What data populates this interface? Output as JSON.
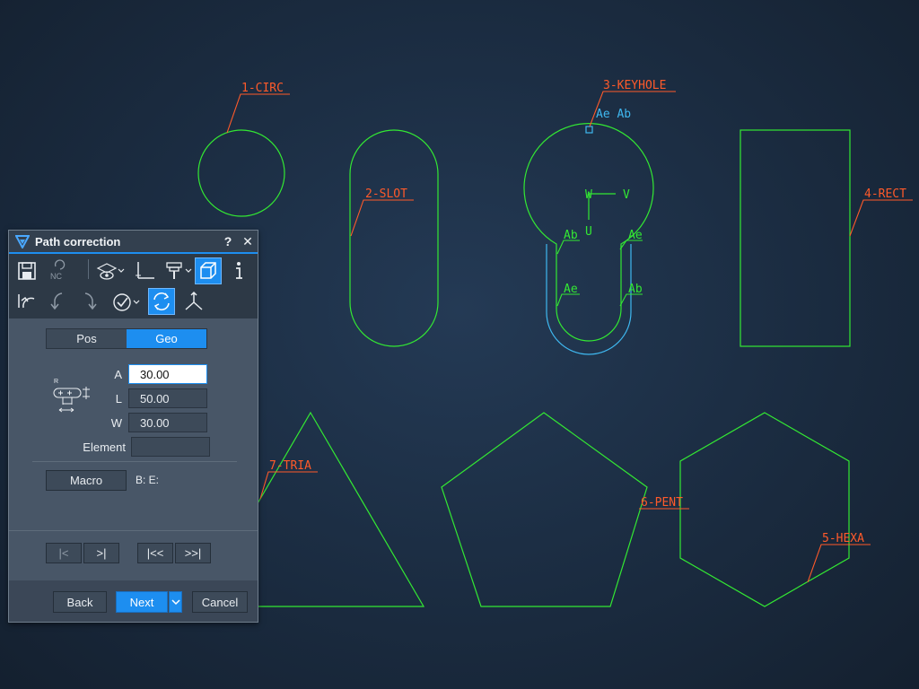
{
  "canvas": {
    "labels": {
      "circ": "1-CIRC",
      "slot": "2-SLOT",
      "keyhole": "3-KEYHOLE",
      "rect": "4-RECT",
      "hexa": "5-HEXA",
      "pent": "6-PENT",
      "tria": "7-TRIA"
    },
    "keyhole_marks": {
      "top": "Ae Ab",
      "w": "W",
      "v": "V",
      "u": "U",
      "ab_left": "Ab",
      "ae_right": "Ae",
      "ae_left": "Ae",
      "ab_right": "Ab"
    }
  },
  "dialog": {
    "title": "Path correction",
    "help": "?",
    "close": "✕",
    "tabs": {
      "pos": "Pos",
      "geo": "Geo",
      "active": "Geo"
    },
    "fields": {
      "a_label": "A",
      "a_value": "30.00",
      "l_label": "L",
      "l_value": "50.00",
      "w_label": "W",
      "w_value": "30.00",
      "element_label": "Element",
      "element_value": ""
    },
    "macro_button": "Macro",
    "be_text": "B: E:",
    "nav": {
      "first": "|<",
      "last": ">|",
      "first_all": "|<<",
      "last_all": ">>|"
    },
    "footer": {
      "back": "Back",
      "next": "Next",
      "cancel": "Cancel"
    }
  },
  "colors": {
    "geometry": "#33e833",
    "label": "#ff5a2a",
    "path": "#3fb8f0",
    "accent": "#1d8ef0"
  }
}
